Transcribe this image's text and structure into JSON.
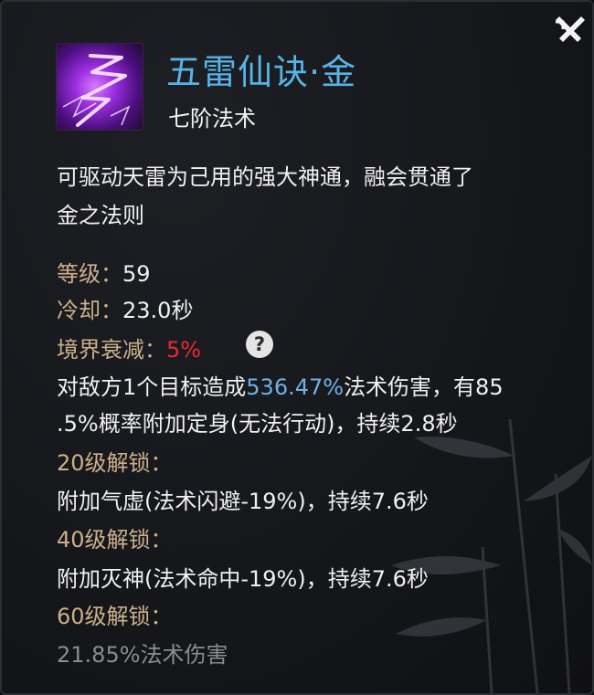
{
  "header": {
    "title": "五雷仙诀·金",
    "subtitle": "七阶法术"
  },
  "description": {
    "line1": "可驱动天雷为己用的强大神通，融会贯通了",
    "line2": "金之法则"
  },
  "stats": {
    "level_label": "等级：",
    "level_value": "59",
    "cooldown_label": "冷却：",
    "cooldown_value": "23.0秒",
    "realm_label": "境界衰减：",
    "realm_value": "5%"
  },
  "effect": {
    "pre": "对敌方1个目标造成",
    "damage": "536.47%",
    "post": "法术伤害，有85",
    "line2": ".5%概率附加定身(无法行动)，持续2.8秒"
  },
  "unlocks": [
    {
      "label": "20级解锁：",
      "text": "附加气虚(法术闪避-19%)，持续7.6秒"
    },
    {
      "label": "40级解锁：",
      "text": "附加灭神(法术命中-19%)，持续7.6秒"
    },
    {
      "label": "60级解锁：",
      "text": "21.85%法术伤害"
    }
  ],
  "icons": {
    "close": "close-icon",
    "skill": "lightning-skill-icon",
    "help": "question-icon"
  },
  "help_glyph": "?",
  "colors": {
    "title": "#58b3e6",
    "label": "#cdb08a",
    "value_red": "#ee2a2a",
    "value_blue": "#6fb1e8",
    "locked_text": "#8a8c90"
  }
}
